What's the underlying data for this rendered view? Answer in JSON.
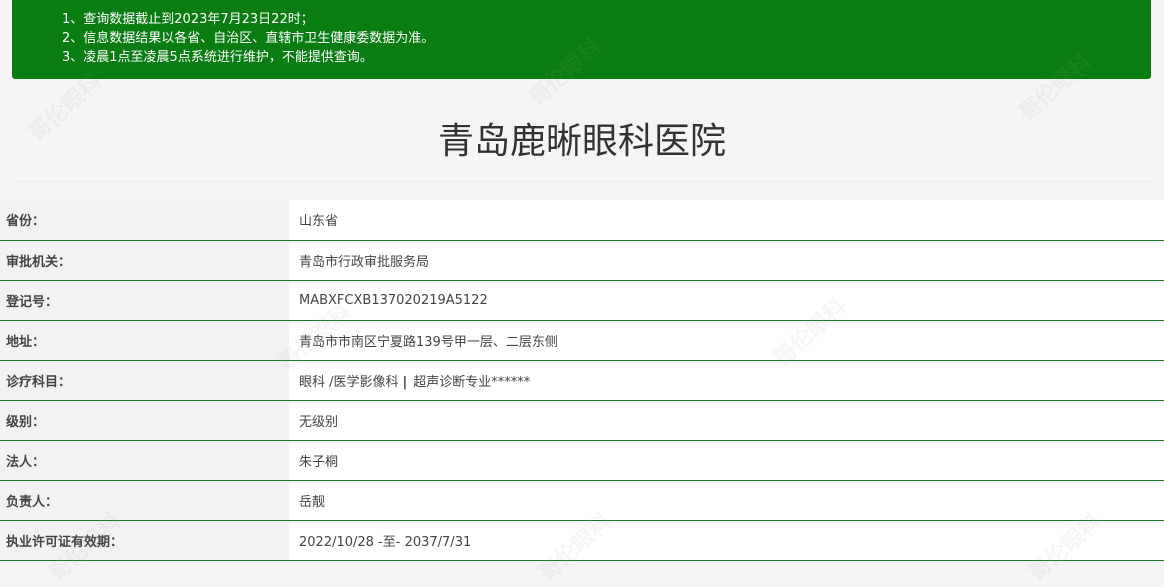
{
  "notice": {
    "lines": [
      "1、查询数据截止到2023年7月23日22时；",
      "2、信息数据结果以各省、自治区、直辖市卫生健康委数据为准。",
      "3、凌晨1点至凌晨5点系统进行维护，不能提供查询。"
    ]
  },
  "hospital": {
    "name": "青岛鹿晰眼科医院"
  },
  "fields": [
    {
      "label": "省份：",
      "value": "山东省"
    },
    {
      "label": "审批机关：",
      "value": "青岛市行政审批服务局"
    },
    {
      "label": "登记号：",
      "value": "MABXFCXB137020219A5122"
    },
    {
      "label": "地址：",
      "value": "青岛市市南区宁夏路139号甲一层、二层东侧"
    },
    {
      "label": "诊疗科目：",
      "value_parts": [
        "眼科 /医学影像科",
        "|",
        "超声诊断专业******"
      ]
    },
    {
      "label": "级别：",
      "value": "无级别"
    },
    {
      "label": "法人：",
      "value": "朱子桐"
    },
    {
      "label": "负责人：",
      "value": "岳靓"
    },
    {
      "label": "执业许可证有效期：",
      "value": "2022/10/28 -至- 2037/7/31"
    }
  ],
  "colors": {
    "notice_bg": "#0a7d12",
    "row_border": "#1f7a2c"
  },
  "watermark_text": "哥伦眼科"
}
